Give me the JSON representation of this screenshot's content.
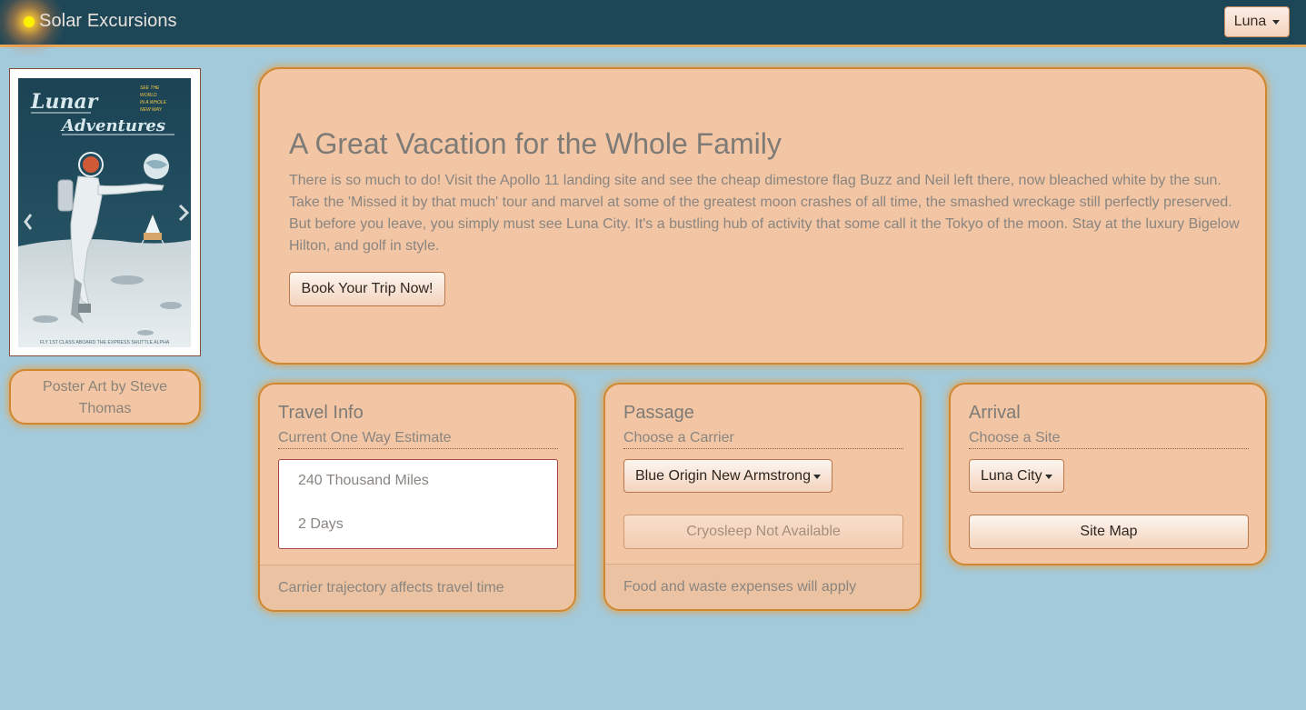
{
  "navbar": {
    "brand": "Solar Excursions",
    "destination_dropdown": "Luna"
  },
  "poster": {
    "title_line1": "Lunar",
    "title_line2": "Adventures",
    "tagline": [
      "SEE THE",
      "WORLD",
      "IN A WHOLE",
      "NEW WAY"
    ],
    "bottom_text": "FLY 1ST CLASS ABOARD THE EXPRESS SHUTTLE ALPHA",
    "credit": "Poster Art by  Steve Thomas"
  },
  "hero": {
    "title": "A Great Vacation for the Whole Family",
    "text": "There is so much to do! Visit the Apollo 11 landing site and see the cheap dimestore flag Buzz and Neil left there, now bleached white by the sun. Take the 'Missed it by that much' tour and marvel at some of the greatest moon crashes of all time, the smashed wreckage still perfectly preserved. But before you leave, you simply must see Luna City. It's a bustling hub of activity that some call it the Tokyo of the moon. Stay at the luxury Bigelow Hilton, and golf in style.",
    "button": "Book Your Trip Now!"
  },
  "travel_info": {
    "title": "Travel Info",
    "subtitle": "Current One Way Estimate",
    "items": [
      "240 Thousand Miles",
      "2 Days"
    ],
    "footer": "Carrier trajectory affects travel time"
  },
  "passage": {
    "title": "Passage",
    "subtitle": "Choose a Carrier",
    "carrier_dropdown": "Blue Origin New Armstrong",
    "cryosleep_button": "Cryosleep Not Available",
    "footer": "Food and waste expenses will apply"
  },
  "arrival": {
    "title": "Arrival",
    "subtitle": "Choose a Site",
    "site_dropdown": "Luna City",
    "site_map_button": "Site Map"
  },
  "colors": {
    "navbar": "#1d4757",
    "page_background": "#a3cadb",
    "card_background": "#f2c6a4",
    "card_glow": "#f59628"
  }
}
